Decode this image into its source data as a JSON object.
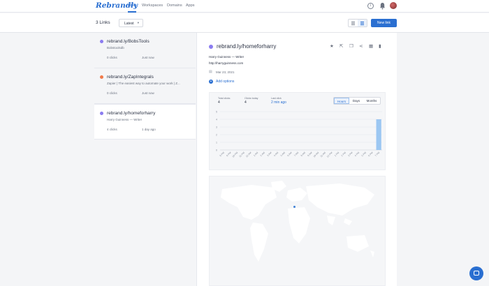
{
  "brand": {
    "name": "Rebrandly",
    "accent": "#2a6fd1"
  },
  "nav": {
    "items": [
      {
        "label": "Links",
        "active": true
      },
      {
        "label": "Workspaces",
        "active": false
      },
      {
        "label": "Domains",
        "active": false
      },
      {
        "label": "Apps",
        "active": false
      }
    ]
  },
  "toolbar": {
    "links_count": "3 Links",
    "sort_value": "Latest",
    "new_link_label": "New link"
  },
  "links": [
    {
      "title": "rebrand.ly/BobsTools",
      "subtitle": "Bobstoolsdb",
      "clicks": "0 clicks",
      "time": "Just now",
      "icon_color": "#8b7cf0"
    },
    {
      "title": "rebrand.ly/ZapIntegrals",
      "subtitle": "Zapier | The easiest way to automate your work | Z...",
      "clicks": "0 clicks",
      "time": "Just now",
      "icon_color": "#f07a4a"
    },
    {
      "title": "rebrand.ly/homeforharry",
      "subtitle": "Harry Guinness — Writer",
      "clicks": "4 clicks",
      "time": "1 day ago",
      "icon_color": "#8b7cf0"
    }
  ],
  "detail": {
    "title": "rebrand.ly/homeforharry",
    "description": "Harry Guinness — Writer",
    "destination": "http://harryguinness.com",
    "created": "Mar 23, 2021",
    "add_options": "Add options",
    "stats": [
      {
        "label": "Total clicks",
        "value": "4"
      },
      {
        "label": "Clicks today",
        "value": "4"
      },
      {
        "label": "Last click",
        "value": "2 min ago"
      }
    ],
    "range_tabs": [
      "Hours",
      "Days",
      "Months"
    ],
    "active_range": "Hours"
  },
  "chart_data": {
    "type": "bar",
    "title": "",
    "xlabel": "",
    "ylabel": "",
    "ylim": [
      0,
      5
    ],
    "yticks": [
      0,
      1,
      2,
      3,
      4,
      5
    ],
    "categories": [
      "8 PM",
      "9 PM",
      "10 PM",
      "11 PM",
      "12 AM",
      "1 AM",
      "2 AM",
      "3 AM",
      "4 AM",
      "5 AM",
      "6 AM",
      "7 AM",
      "8 AM",
      "9 AM",
      "10 AM",
      "11 AM",
      "12 PM",
      "1 PM",
      "2 PM",
      "3 PM",
      "4 PM",
      "5 PM",
      "6 PM",
      "7 PM"
    ],
    "values": [
      0,
      0,
      0,
      0,
      0,
      0,
      0,
      0,
      0,
      0,
      0,
      0,
      0,
      0,
      0,
      0,
      0,
      0,
      0,
      0,
      0,
      0,
      0,
      4
    ],
    "bar_color": "#9cc7f2"
  },
  "icons": {
    "star": "star-icon",
    "open": "external-link-icon",
    "copy": "copy-icon",
    "share": "share-icon",
    "qr": "qr-code-icon",
    "delete": "trash-icon"
  }
}
